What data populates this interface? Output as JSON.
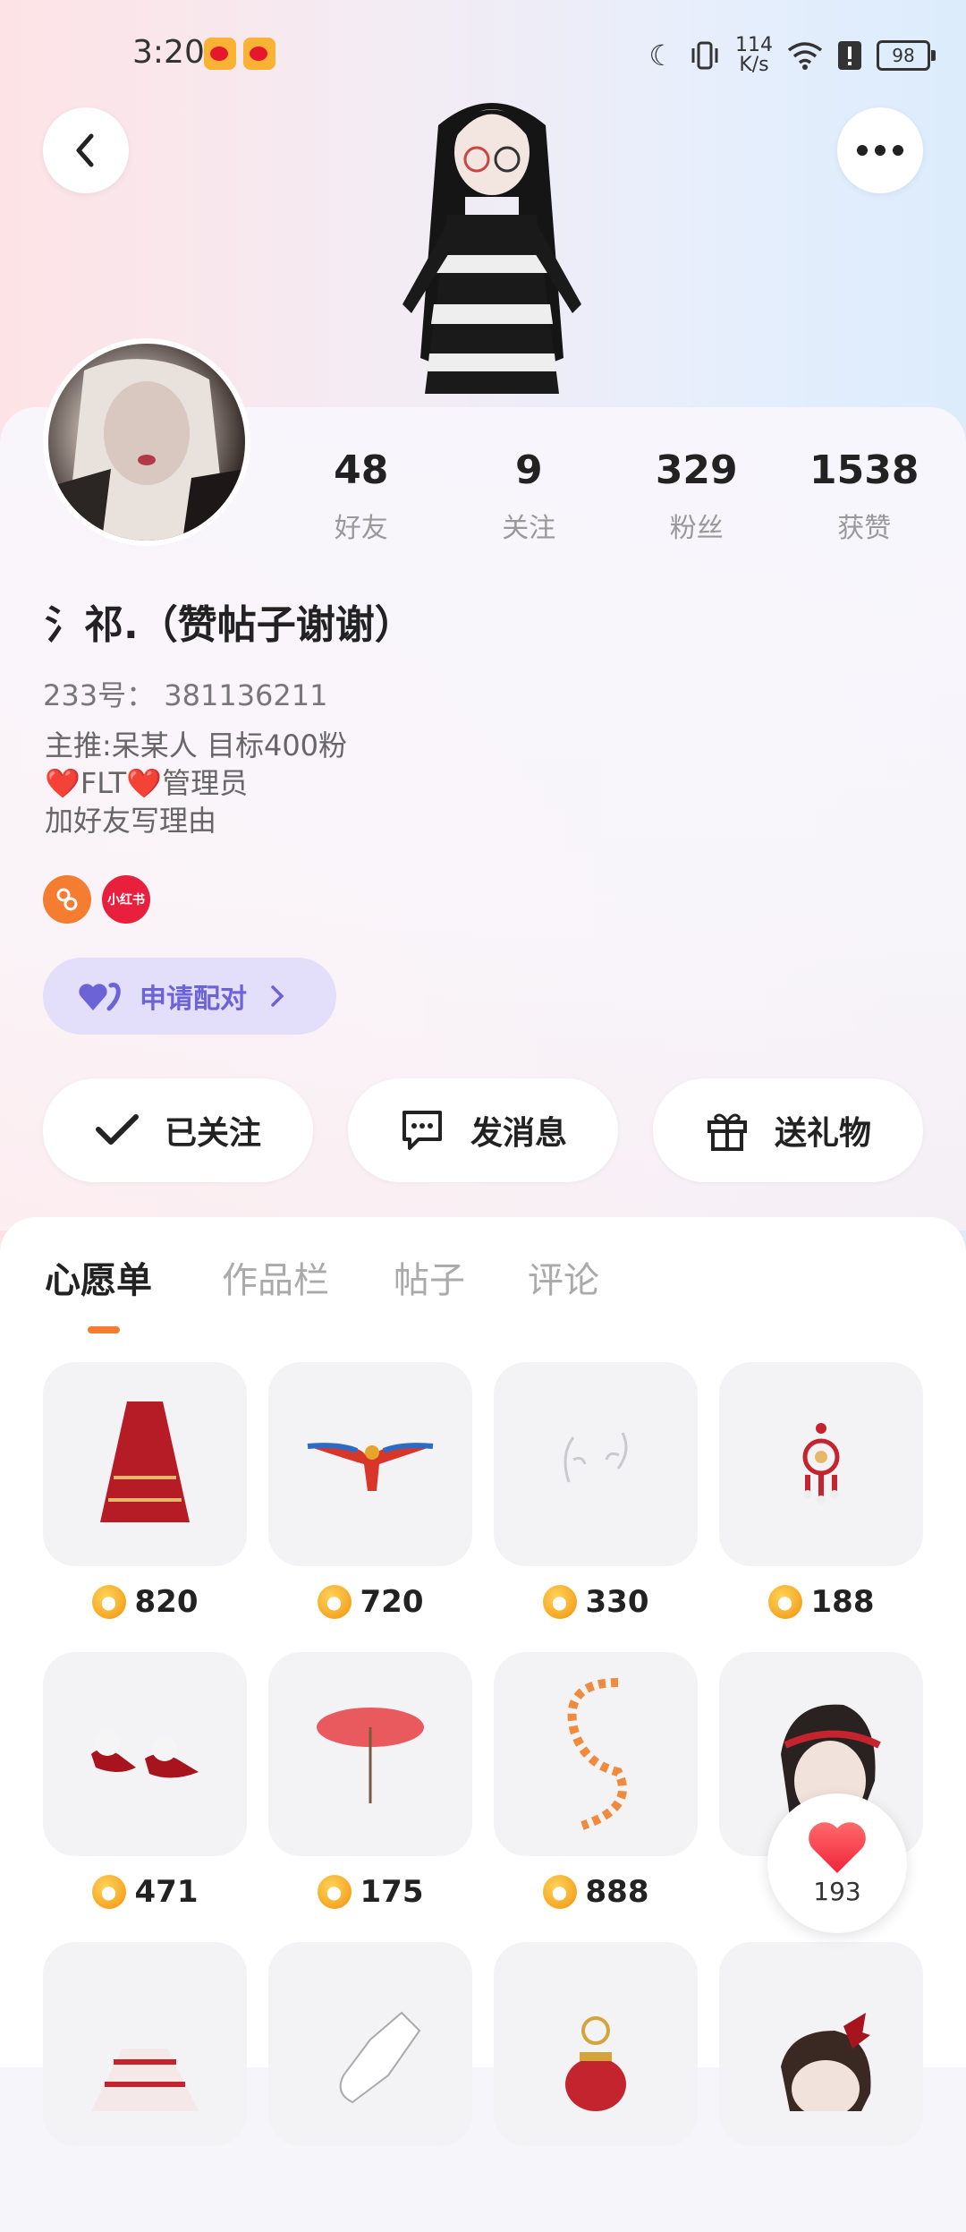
{
  "status_bar": {
    "time": "3:20",
    "net_speed_value": "114",
    "net_speed_unit": "K/s",
    "battery": "98"
  },
  "stats": [
    {
      "value": "48",
      "label": "好友"
    },
    {
      "value": "9",
      "label": "关注"
    },
    {
      "value": "329",
      "label": "粉丝"
    },
    {
      "value": "1538",
      "label": "获赞"
    }
  ],
  "profile": {
    "nickname": "氵祁.（赞帖子谢谢）",
    "uid": "233号： 381136211",
    "bio": "主推:呆某人 目标400粉\n❤️FLT❤️管理员\n加好友写理由",
    "xiaohongshu_badge": "小红书"
  },
  "pair_button": {
    "label": "申请配对"
  },
  "actions": {
    "follow": "已关注",
    "message": "发消息",
    "gift": "送礼物"
  },
  "tabs": [
    "心愿单",
    "作品栏",
    "帖子",
    "评论"
  ],
  "wishlist": [
    {
      "icon": "red-skirt",
      "price": "820"
    },
    {
      "icon": "parrot",
      "price": "720"
    },
    {
      "icon": "hair-ornament",
      "price": "330"
    },
    {
      "icon": "earring",
      "price": "188"
    },
    {
      "icon": "red-shoes",
      "price": "471"
    },
    {
      "icon": "red-umbrella",
      "price": "175"
    },
    {
      "icon": "petal-ribbon",
      "price": "888"
    },
    {
      "icon": "headband-hair",
      "price": ""
    },
    {
      "icon": "red-dress",
      "price": ""
    },
    {
      "icon": "white-sock",
      "price": ""
    },
    {
      "icon": "lantern",
      "price": ""
    },
    {
      "icon": "red-bow-hair",
      "price": ""
    }
  ],
  "like_fab": {
    "count": "193"
  },
  "colors": {
    "accent_orange": "#f47d31",
    "pair_purple": "#6b63d6",
    "like_red": "#ff3b4e"
  }
}
